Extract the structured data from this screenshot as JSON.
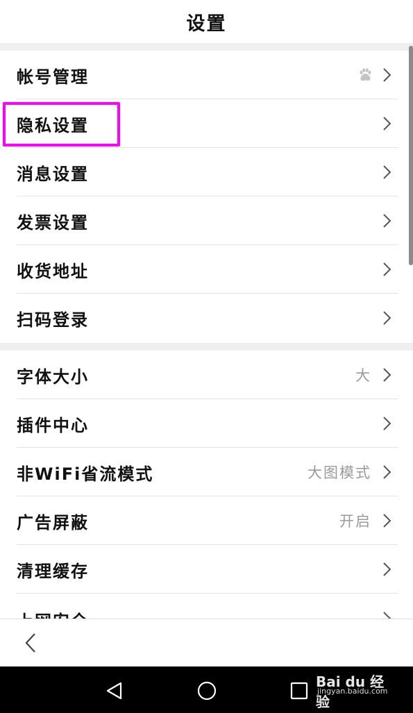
{
  "header": {
    "title": "设置"
  },
  "group1": [
    {
      "label": "帐号管理",
      "trailing_icon": "baidu-paw-icon"
    },
    {
      "label": "隐私设置"
    },
    {
      "label": "消息设置"
    },
    {
      "label": "发票设置"
    },
    {
      "label": "收货地址"
    },
    {
      "label": "扫码登录"
    }
  ],
  "group2": [
    {
      "label": "字体大小",
      "value": "大"
    },
    {
      "label": "插件中心"
    },
    {
      "label": "非WiFi省流模式",
      "value": "大图模式"
    },
    {
      "label": "广告屏蔽",
      "value": "开启"
    },
    {
      "label": "清理缓存"
    },
    {
      "label": "上网安全"
    }
  ],
  "highlight_color": "#ff00ff",
  "watermark": {
    "brand": "Bai du 经验",
    "url": "jingyan.baidu.com"
  }
}
